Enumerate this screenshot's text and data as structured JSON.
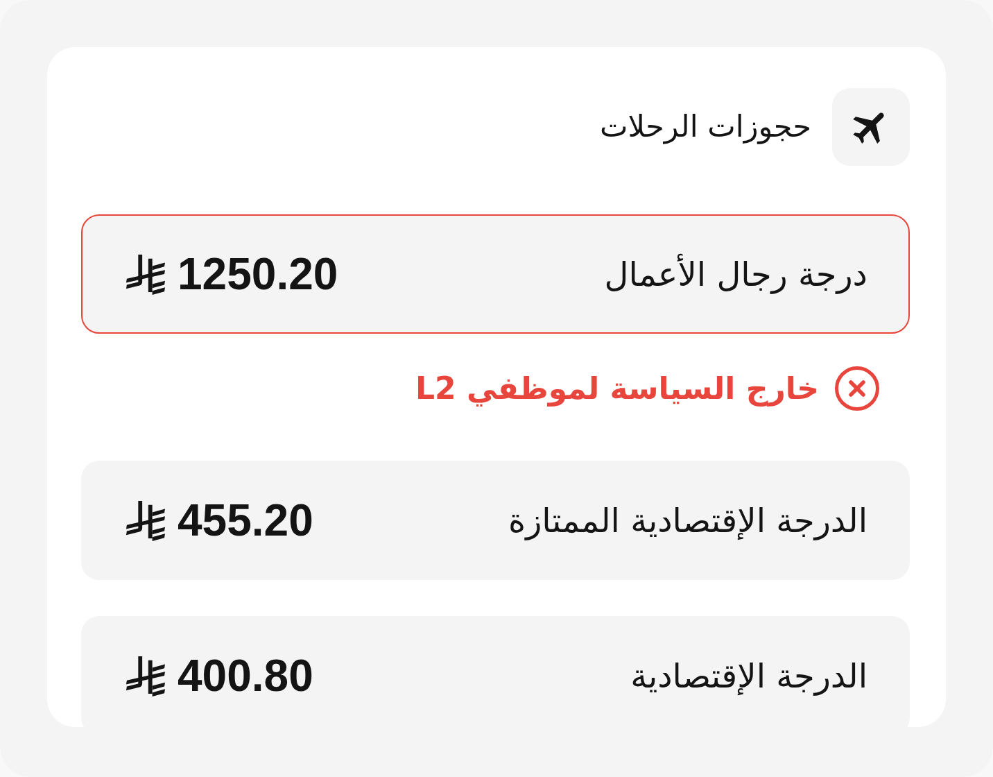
{
  "header": {
    "title": "حجوزات الرحلات"
  },
  "fares": [
    {
      "name": "درجة رجال الأعمال",
      "price": "1250.20",
      "out_of_policy": true,
      "policy_note": "خارج السياسة لموظفي L2"
    },
    {
      "name": "الدرجة الإقتصادية الممتازة",
      "price": "455.20",
      "out_of_policy": false
    },
    {
      "name": "الدرجة الإقتصادية",
      "price": "400.80",
      "out_of_policy": false
    }
  ]
}
